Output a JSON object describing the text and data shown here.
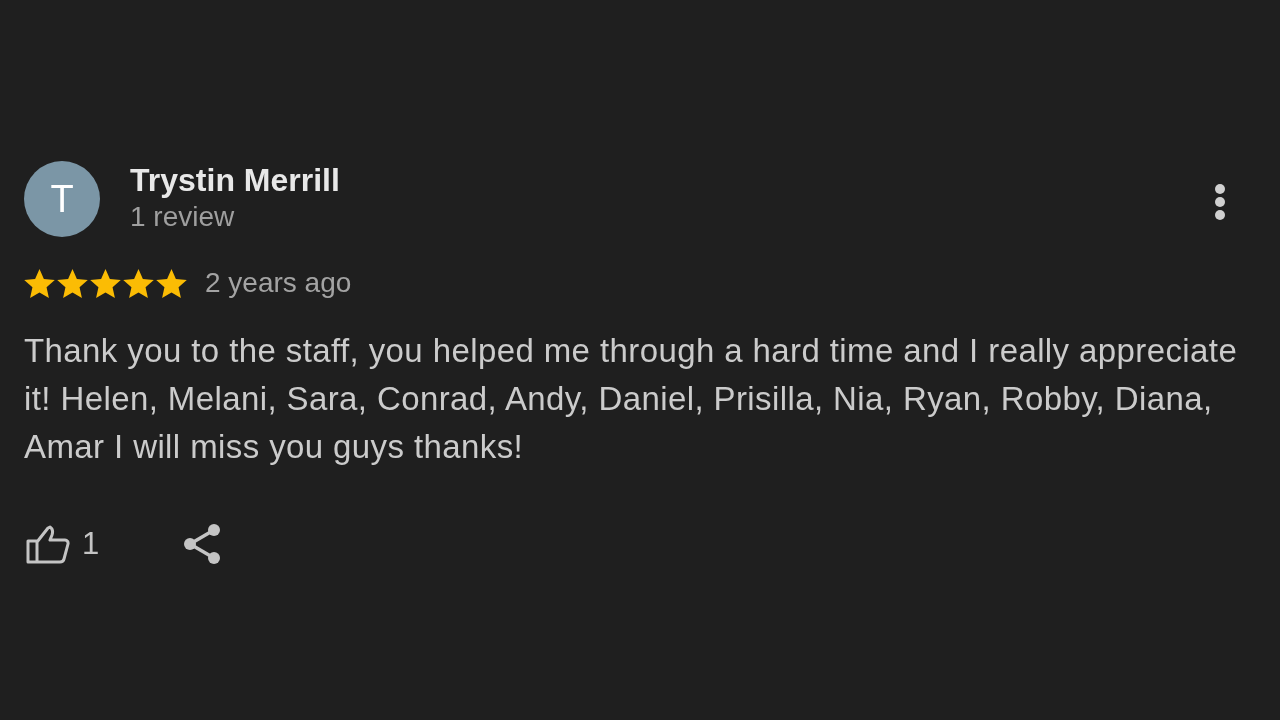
{
  "review": {
    "author": {
      "initial": "T",
      "name": "Trystin Merrill",
      "review_count": "1 review"
    },
    "stars": 5,
    "time": "2 years ago",
    "text": "Thank you to the staff, you helped me through a hard time and I really appreciate it! Helen, Melani, Sara, Conrad, Andy, Daniel, Prisilla, Nia, Ryan, Robby, Diana, Amar I will miss you guys thanks!",
    "likes": "1"
  }
}
